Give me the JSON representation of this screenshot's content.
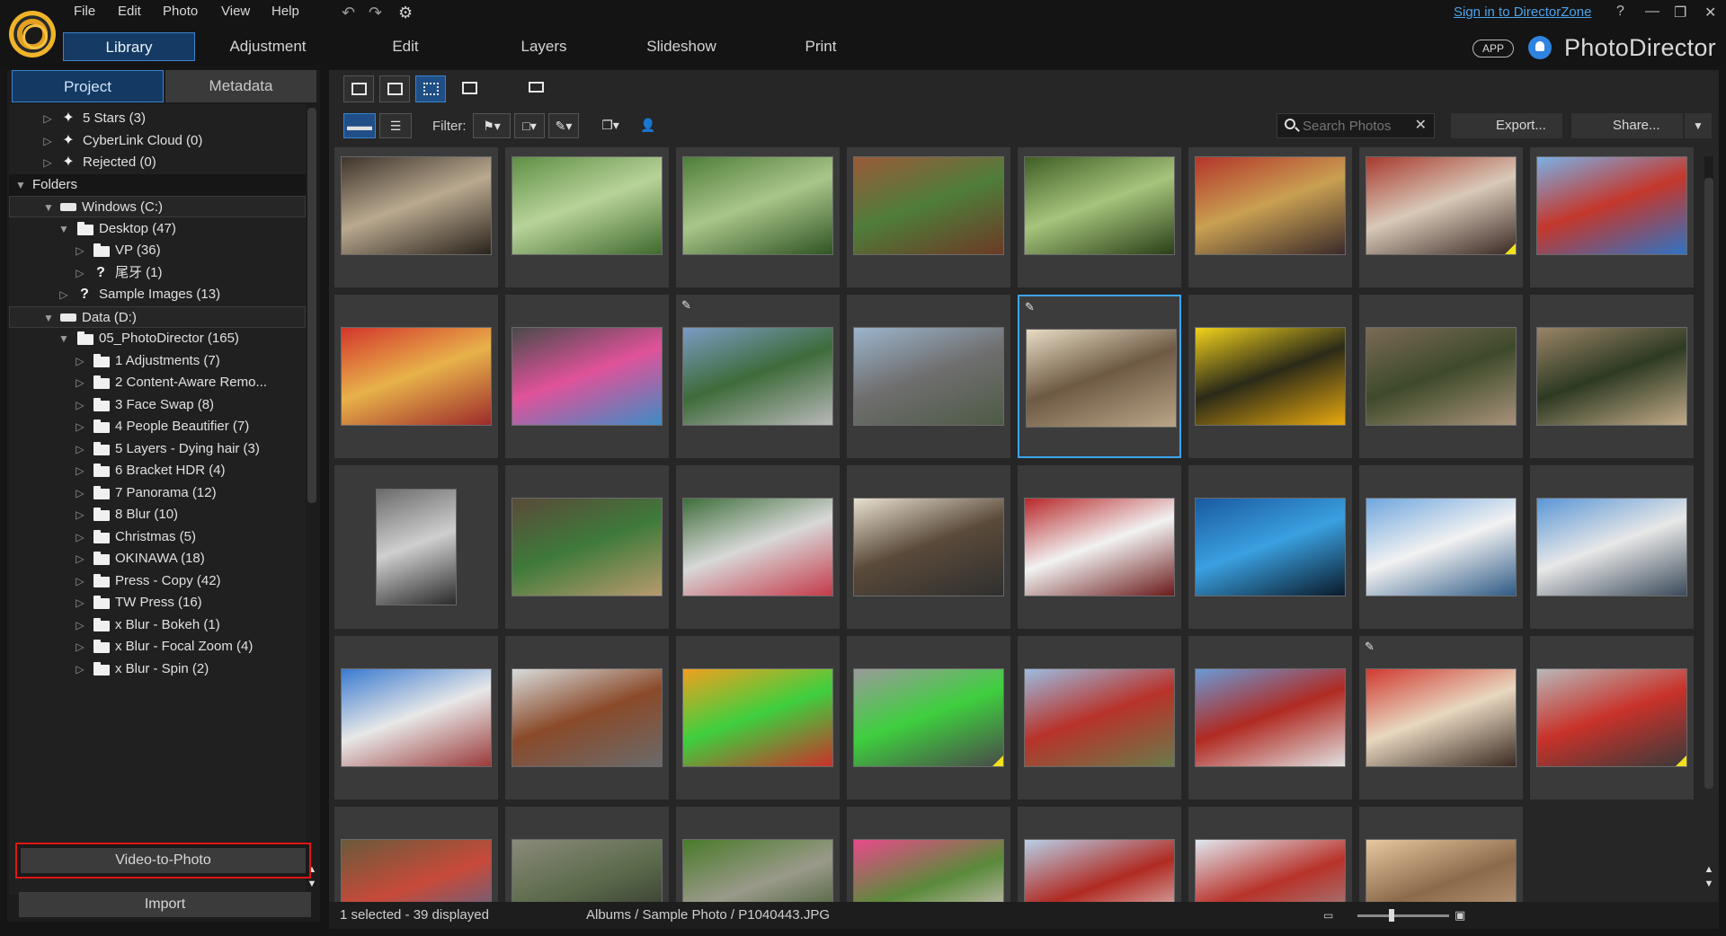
{
  "menu": [
    "File",
    "Edit",
    "Photo",
    "View",
    "Help"
  ],
  "signin": "Sign in to DirectorZone",
  "window_controls": [
    "?",
    "—",
    "❐",
    "✕"
  ],
  "modules": [
    {
      "label": "Library",
      "active": true
    },
    {
      "label": "Adjustment"
    },
    {
      "label": "Edit"
    },
    {
      "label": "Layers"
    },
    {
      "label": "Slideshow"
    },
    {
      "label": "Print"
    }
  ],
  "app_badge": "APP",
  "brand": "PhotoDirector",
  "panel_tabs": {
    "project": "Project",
    "metadata": "Metadata"
  },
  "tree": [
    {
      "label": "5 Stars (3)",
      "level": 1,
      "icon": "sparkle-icon"
    },
    {
      "label": "CyberLink Cloud (0)",
      "level": 1,
      "icon": "sparkle-icon"
    },
    {
      "label": "Rejected (0)",
      "level": 1,
      "icon": "sparkle-icon"
    },
    {
      "label": "Folders",
      "level": 0,
      "kind": "section",
      "expanded": true
    },
    {
      "label": "Windows (C:)",
      "level": 1,
      "kind": "drive",
      "expanded": true
    },
    {
      "label": "Desktop (47)",
      "level": 2,
      "icon": "folder-icon",
      "expanded": true
    },
    {
      "label": "VP (36)",
      "level": 3,
      "icon": "folder-icon"
    },
    {
      "label": "尾牙 (1)",
      "level": 3,
      "icon": "question-icon"
    },
    {
      "label": "Sample Images (13)",
      "level": 2,
      "icon": "question-icon"
    },
    {
      "label": "Data (D:)",
      "level": 1,
      "kind": "drive",
      "expanded": true
    },
    {
      "label": "05_PhotoDirector (165)",
      "level": 2,
      "icon": "folder-icon",
      "expanded": true
    },
    {
      "label": "1 Adjustments (7)",
      "level": 3,
      "icon": "folder-icon"
    },
    {
      "label": "2 Content-Aware Remo...",
      "level": 3,
      "icon": "folder-icon"
    },
    {
      "label": "3 Face Swap (8)",
      "level": 3,
      "icon": "folder-icon"
    },
    {
      "label": "4 People Beautifier (7)",
      "level": 3,
      "icon": "folder-icon"
    },
    {
      "label": "5 Layers - Dying hair (3)",
      "level": 3,
      "icon": "folder-icon"
    },
    {
      "label": "6 Bracket HDR (4)",
      "level": 3,
      "icon": "folder-icon"
    },
    {
      "label": "7 Panorama (12)",
      "level": 3,
      "icon": "folder-icon"
    },
    {
      "label": "8 Blur (10)",
      "level": 3,
      "icon": "folder-icon"
    },
    {
      "label": "Christmas (5)",
      "level": 3,
      "icon": "folder-icon"
    },
    {
      "label": "OKINAWA (18)",
      "level": 3,
      "icon": "folder-icon"
    },
    {
      "label": "Press - Copy (42)",
      "level": 3,
      "icon": "folder-icon"
    },
    {
      "label": "TW Press (16)",
      "level": 3,
      "icon": "folder-icon"
    },
    {
      "label": "x Blur - Bokeh (1)",
      "level": 3,
      "icon": "folder-icon"
    },
    {
      "label": "x Blur - Focal Zoom (4)",
      "level": 3,
      "icon": "folder-icon"
    },
    {
      "label": "x Blur - Spin (2)",
      "level": 3,
      "icon": "folder-icon"
    }
  ],
  "buttons": {
    "video_to_photo": "Video-to-Photo",
    "import": "Import"
  },
  "toolbar": {
    "filter_label": "Filter:",
    "search_placeholder": "Search Photos",
    "export": "Export...",
    "share": "Share..."
  },
  "photos": [
    {
      "colors": [
        "#3e342c",
        "#b9a98f",
        "#2a231c"
      ],
      "flags": []
    },
    {
      "colors": [
        "#5f8f45",
        "#b8d39a",
        "#3f6a2e"
      ],
      "flags": []
    },
    {
      "colors": [
        "#4f7d3a",
        "#a9c68a",
        "#2f5423"
      ],
      "flags": []
    },
    {
      "colors": [
        "#9a5a3a",
        "#4f7d3a",
        "#6b3a25"
      ],
      "flags": []
    },
    {
      "colors": [
        "#3f5e25",
        "#a6c47b",
        "#2a3f19"
      ],
      "flags": []
    },
    {
      "colors": [
        "#b3352a",
        "#c9a052",
        "#3a2a2a"
      ],
      "flags": []
    },
    {
      "colors": [
        "#a83a2e",
        "#d8c9b8",
        "#3a2a25"
      ],
      "flags": [
        "corner"
      ]
    },
    {
      "colors": [
        "#7ab0e6",
        "#c4372c",
        "#2f73c4"
      ],
      "flags": []
    },
    {
      "colors": [
        "#d3362c",
        "#e8b24a",
        "#9c2a2a"
      ],
      "flags": []
    },
    {
      "colors": [
        "#4a4a4a",
        "#e0529a",
        "#3e8cc4"
      ],
      "flags": []
    },
    {
      "colors": [
        "#7c9bc4",
        "#3e6b3a",
        "#b8b8b8"
      ],
      "flags": [
        "edit"
      ]
    },
    {
      "colors": [
        "#9cb4cc",
        "#6f6f6f",
        "#4e5a46"
      ],
      "flags": []
    },
    {
      "colors": [
        "#e8dcc4",
        "#6e5a44",
        "#b9a688"
      ],
      "flags": [
        "edit",
        "selected"
      ]
    },
    {
      "colors": [
        "#f2d21c",
        "#2b2a18",
        "#e6a80e"
      ],
      "flags": []
    },
    {
      "colors": [
        "#7a6a56",
        "#3e4a2a",
        "#a8927a"
      ],
      "flags": []
    },
    {
      "colors": [
        "#9a8468",
        "#2d3a22",
        "#c2aa88"
      ],
      "flags": []
    },
    {
      "colors": [
        "#6b6b6b",
        "#cfcfcf",
        "#2a2a2a"
      ],
      "flags": [
        "portrait"
      ]
    },
    {
      "colors": [
        "#5a4a3a",
        "#3e7a3a",
        "#b89a6e"
      ],
      "flags": []
    },
    {
      "colors": [
        "#3e6e3a",
        "#d8d8d8",
        "#c43a4a"
      ],
      "flags": []
    },
    {
      "colors": [
        "#e8e0d0",
        "#5a4a3a",
        "#2f2f2f"
      ],
      "flags": []
    },
    {
      "colors": [
        "#b8282a",
        "#f2f2f2",
        "#6a1a1a"
      ],
      "flags": []
    },
    {
      "colors": [
        "#1a5aa0",
        "#3aa0e0",
        "#0a1a2a"
      ],
      "flags": []
    },
    {
      "colors": [
        "#6fa6de",
        "#f2f2f2",
        "#2f5a86"
      ],
      "flags": []
    },
    {
      "colors": [
        "#5a96d6",
        "#e8e8e8",
        "#3a4a5a"
      ],
      "flags": []
    },
    {
      "colors": [
        "#3a7ad0",
        "#e8e8e8",
        "#9a3a3a"
      ],
      "flags": []
    },
    {
      "colors": [
        "#d8dcdc",
        "#8a4a2a",
        "#6a6a6a"
      ],
      "flags": []
    },
    {
      "colors": [
        "#f0a020",
        "#3ecf3e",
        "#c8322a"
      ],
      "flags": []
    },
    {
      "colors": [
        "#9a9a9a",
        "#3ecf3e",
        "#4a4a4a"
      ],
      "flags": [
        "corner"
      ]
    },
    {
      "colors": [
        "#9cbce0",
        "#b8322a",
        "#6a7a4a"
      ],
      "flags": []
    },
    {
      "colors": [
        "#6a9ad6",
        "#b02a22",
        "#e0e0e0"
      ],
      "flags": []
    },
    {
      "colors": [
        "#d03a30",
        "#e8d8c0",
        "#3a2a22"
      ],
      "flags": [
        "edit"
      ]
    },
    {
      "colors": [
        "#b8b8b8",
        "#c8322a",
        "#3a3a3a"
      ],
      "flags": [
        "corner"
      ]
    },
    {
      "colors": [
        "#6a5a3a",
        "#c84a3a",
        "#3e6a9a"
      ],
      "flags": []
    },
    {
      "colors": [
        "#8a8a7a",
        "#5a6a4a",
        "#2a2a2a"
      ],
      "flags": []
    },
    {
      "colors": [
        "#4a7a2a",
        "#9a9a8a",
        "#2a4a1a"
      ],
      "flags": []
    },
    {
      "colors": [
        "#e84a8a",
        "#5a8a3a",
        "#f2d2e2"
      ],
      "flags": []
    },
    {
      "colors": [
        "#b8d0e8",
        "#b02a22",
        "#e8e8e8"
      ],
      "flags": []
    },
    {
      "colors": [
        "#e0e8f0",
        "#b8322a",
        "#9a9a9a"
      ],
      "flags": []
    },
    {
      "colors": [
        "#e8c8a0",
        "#8a6a4a",
        "#c8a888"
      ],
      "flags": []
    }
  ],
  "status": {
    "count": "1 selected - 39 displayed",
    "path": "Albums / Sample Photo / P1040443.JPG"
  },
  "zoom_level": 0.34
}
